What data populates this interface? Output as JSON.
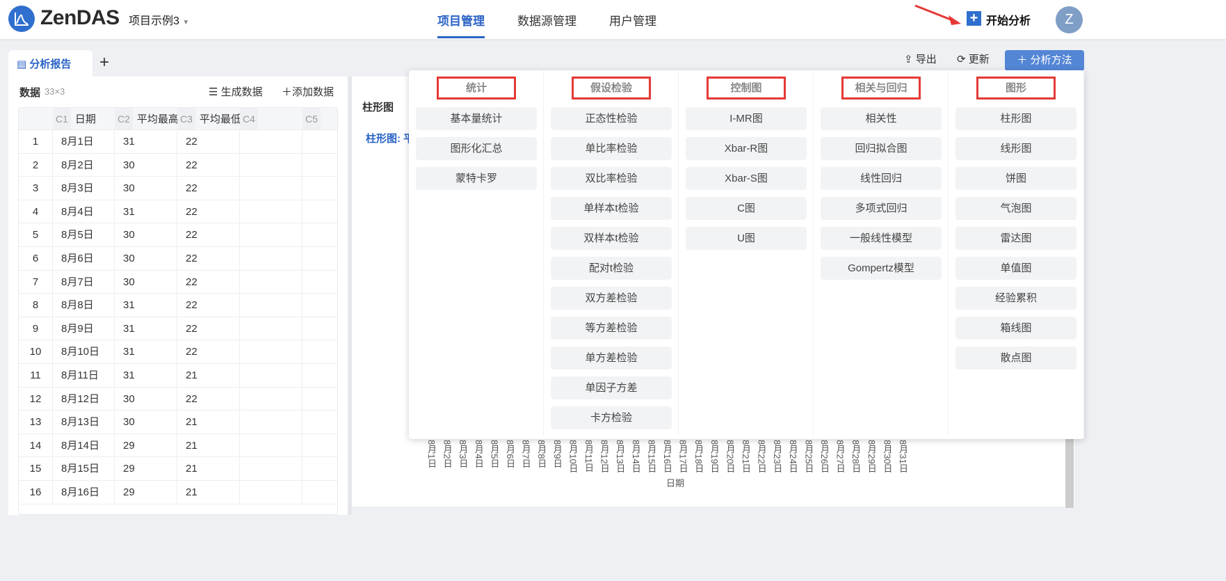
{
  "header": {
    "brand": "ZenDAS",
    "project": "项目示例3",
    "nav": [
      "项目管理",
      "数据源管理",
      "用户管理"
    ],
    "start": "开始分析",
    "avatar": "Z"
  },
  "tabs": {
    "active": "分析报告",
    "add": "+"
  },
  "toolbar": {
    "export": "导出",
    "refresh": "更新",
    "method": "分析方法"
  },
  "data_panel": {
    "title": "数据",
    "dim": "33×3",
    "generate": "生成数据",
    "add": "添加数据",
    "columns": [
      {
        "id": "C1",
        "name": "日期"
      },
      {
        "id": "C2",
        "name": "平均最高"
      },
      {
        "id": "C3",
        "name": "平均最低"
      },
      {
        "id": "C4",
        "name": ""
      },
      {
        "id": "C5",
        "name": ""
      }
    ],
    "rows": [
      [
        "1",
        "8月1日",
        "31",
        "22"
      ],
      [
        "2",
        "8月2日",
        "30",
        "22"
      ],
      [
        "3",
        "8月3日",
        "30",
        "22"
      ],
      [
        "4",
        "8月4日",
        "31",
        "22"
      ],
      [
        "5",
        "8月5日",
        "30",
        "22"
      ],
      [
        "6",
        "8月6日",
        "30",
        "22"
      ],
      [
        "7",
        "8月7日",
        "30",
        "22"
      ],
      [
        "8",
        "8月8日",
        "31",
        "22"
      ],
      [
        "9",
        "8月9日",
        "31",
        "22"
      ],
      [
        "10",
        "8月10日",
        "31",
        "22"
      ],
      [
        "11",
        "8月11日",
        "31",
        "21"
      ],
      [
        "12",
        "8月12日",
        "30",
        "22"
      ],
      [
        "13",
        "8月13日",
        "30",
        "21"
      ],
      [
        "14",
        "8月14日",
        "29",
        "21"
      ],
      [
        "15",
        "8月15日",
        "29",
        "21"
      ],
      [
        "16",
        "8月16日",
        "29",
        "21"
      ]
    ]
  },
  "chart": {
    "title": "柱形图",
    "subtitle": "柱形图: 平",
    "xlabel": "日期",
    "xticks": [
      "8月1日",
      "8月2日",
      "8月3日",
      "8月4日",
      "8月5日",
      "8月6日",
      "8月7日",
      "8月8日",
      "8月9日",
      "8月10日",
      "8月11日",
      "8月12日",
      "8月13日",
      "8月14日",
      "8月15日",
      "8月16日",
      "8月17日",
      "8月18日",
      "8月19日",
      "8月20日",
      "8月21日",
      "8月22日",
      "8月23日",
      "8月24日",
      "8月25日",
      "8月26日",
      "8月27日",
      "8月28日",
      "8月29日",
      "8月30日",
      "8月31日"
    ]
  },
  "menu": [
    {
      "title": "统计",
      "items": [
        "基本量统计",
        "图形化汇总",
        "蒙特卡罗"
      ]
    },
    {
      "title": "假设检验",
      "items": [
        "正态性检验",
        "单比率检验",
        "双比率检验",
        "单样本t检验",
        "双样本t检验",
        "配对t检验",
        "双方差检验",
        "等方差检验",
        "单方差检验",
        "单因子方差",
        "卡方检验"
      ]
    },
    {
      "title": "控制图",
      "items": [
        "I-MR图",
        "Xbar-R图",
        "Xbar-S图",
        "C图",
        "U图"
      ]
    },
    {
      "title": "相关与回归",
      "items": [
        "相关性",
        "回归拟合图",
        "线性回归",
        "多项式回归",
        "一般线性模型",
        "Gompertz模型"
      ]
    },
    {
      "title": "图形",
      "items": [
        "柱形图",
        "线形图",
        "饼图",
        "气泡图",
        "雷达图",
        "单值图",
        "经验累积",
        "箱线图",
        "散点图"
      ]
    }
  ],
  "colors": {
    "accent": "#2b63c6",
    "button": "#5486d6",
    "highlight": "#e53935"
  }
}
